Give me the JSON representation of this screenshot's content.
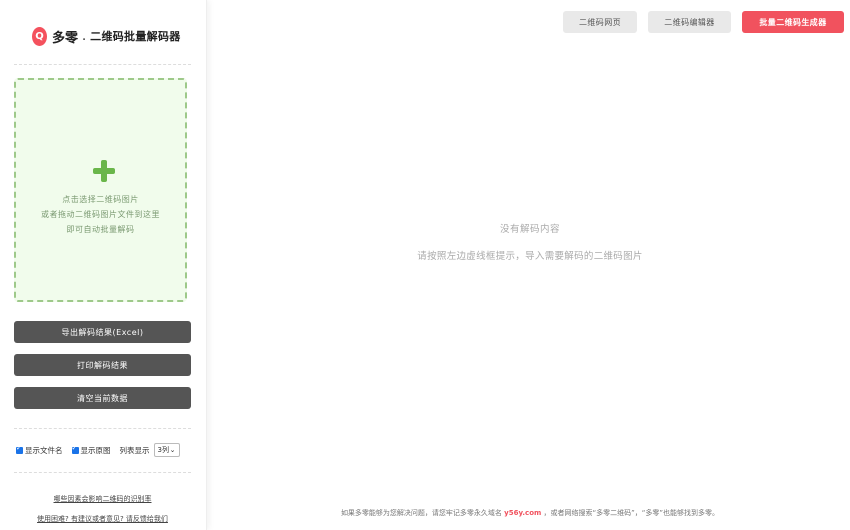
{
  "logo": {
    "icon_letter": "Q",
    "brand": "多零",
    "dot": ".",
    "subtitle": "二维码批量解码器"
  },
  "dropzone": {
    "icon": "plus-icon",
    "lines": [
      "点击选择二维码图片",
      "或者拖动二维码图片文件到这里",
      "即可自动批量解码"
    ]
  },
  "buttons": {
    "export": "导出解码结果(Excel)",
    "print": "打印解码结果",
    "clear": "清空当前数据"
  },
  "options": {
    "show_filename": {
      "label": "显示文件名",
      "checked": true
    },
    "show_image": {
      "label": "显示原图",
      "checked": true
    },
    "list_display_label": "列表显示",
    "list_display_value": "3列"
  },
  "links": {
    "line1": "哪些因素会影响二维码的识别率",
    "line2": "使用困难? 有建议或者意见? 请反馈给我们"
  },
  "top_nav": {
    "qr_page": "二维码网页",
    "qr_editor": "二维码编辑器",
    "batch_generator": "批量二维码生成器"
  },
  "main": {
    "empty_title": "没有解码内容",
    "empty_hint": "请按照左边虚线框提示，导入需要解码的二维码图片"
  },
  "footer": {
    "text_before": "如果多零能够为您解决问题，请您牢记多零永久域名 ",
    "site": "y56y.com",
    "text_after": " ，或者网络搜索“多零二维码”，“多零”也能够找到多零。"
  },
  "colors": {
    "accent_red": "#f1525e",
    "dropzone_green": "#6ab64a",
    "dark_button": "#555555"
  }
}
